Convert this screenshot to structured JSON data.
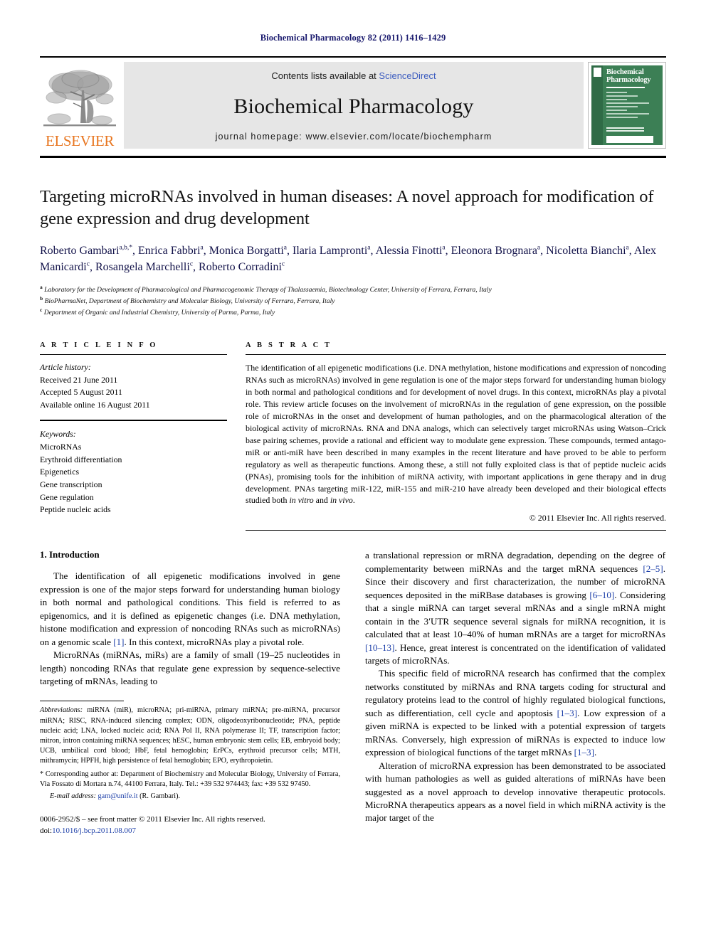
{
  "running_head": "Biochemical Pharmacology 82 (2011) 1416–1429",
  "masthead": {
    "contents_prefix": "Contents lists available at ",
    "sciencedirect": "ScienceDirect",
    "journal_title": "Biochemical Pharmacology",
    "homepage": "journal homepage: www.elsevier.com/locate/biochempharm",
    "publisher_wordmark": "ELSEVIER",
    "cover_title_line1": "Biochemical",
    "cover_title_line2": "Pharmacology"
  },
  "article": {
    "title": "Targeting microRNAs involved in human diseases: A novel approach for modification of gene expression and drug development",
    "authors_line1": "Roberto Gambari",
    "authors": [
      {
        "name": "Roberto Gambari",
        "sup": "a,b,*"
      },
      {
        "name": "Enrica Fabbri",
        "sup": "a"
      },
      {
        "name": "Monica Borgatti",
        "sup": "a"
      },
      {
        "name": "Ilaria Lampronti",
        "sup": "a"
      },
      {
        "name": "Alessia Finotti",
        "sup": "a"
      },
      {
        "name": "Eleonora Brognara",
        "sup": "a"
      },
      {
        "name": "Nicoletta Bianchi",
        "sup": "a"
      },
      {
        "name": "Alex Manicardi",
        "sup": "c"
      },
      {
        "name": "Rosangela Marchelli",
        "sup": "c"
      },
      {
        "name": "Roberto Corradini",
        "sup": "c"
      }
    ],
    "affiliations": [
      {
        "sup": "a",
        "text": "Laboratory for the Development of Pharmacological and Pharmacogenomic Therapy of Thalassaemia, Biotechnology Center, University of Ferrara, Ferrara, Italy"
      },
      {
        "sup": "b",
        "text": "BioPharmaNet, Department of Biochemistry and Molecular Biology, University of Ferrara, Ferrara, Italy"
      },
      {
        "sup": "c",
        "text": "Department of Organic and Industrial Chemistry, University of Parma, Parma, Italy"
      }
    ]
  },
  "article_info": {
    "heading": "A R T I C L E  I N F O",
    "history_label": "Article history:",
    "history": [
      "Received 21 June 2011",
      "Accepted 5 August 2011",
      "Available online 16 August 2011"
    ],
    "keywords_label": "Keywords:",
    "keywords": [
      "MicroRNAs",
      "Erythroid differentiation",
      "Epigenetics",
      "Gene transcription",
      "Gene regulation",
      "Peptide nucleic acids"
    ]
  },
  "abstract": {
    "heading": "A B S T R A C T",
    "part1": "The identification of all epigenetic modifications (i.e. DNA methylation, histone modifications and expression of noncoding RNAs such as microRNAs) involved in gene regulation is one of the major steps forward for understanding human biology in both normal and pathological conditions and for development of novel drugs. In this context, microRNAs play a pivotal role. This review article focuses on the involvement of microRNAs in the regulation of gene expression, on the possible role of microRNAs in the onset and development of human pathologies, and on the pharmacological alteration of the biological activity of microRNAs. RNA and DNA analogs, which can selectively target microRNAs using Watson–Crick base pairing schemes, provide a rational and efficient way to modulate gene expression. These compounds, termed antago-miR or anti-miR have been described in many examples in the recent literature and have proved to be able to perform regulatory as well as therapeutic functions. Among these, a still not fully exploited class is that of peptide nucleic acids (PNAs), promising tools for the inhibition of miRNA activity, with important applications in gene therapy and in drug development. PNAs targeting miR-122, miR-155 and miR-210 have already been developed and their biological effects studied both ",
    "italic1": "in vitro",
    "mid": " and ",
    "italic2": "in vivo",
    "part2": ".",
    "copyright": "© 2011 Elsevier Inc. All rights reserved."
  },
  "section": {
    "number_title": "1. Introduction"
  },
  "left_column": {
    "p1_a": "The identification of all epigenetic modifications involved in gene expression is one of the major steps forward for understanding human biology in both normal and pathological conditions. This field is referred to as epigenomics, and it is defined as epigenetic changes (i.e. DNA methylation, histone modification and expression of noncoding RNAs such as microRNAs) on a genomic scale ",
    "p1_ref": "[1]",
    "p1_b": ". In this context, microRNAs play a pivotal role.",
    "p2": "MicroRNAs (miRNAs, miRs) are a family of small (19–25 nucleotides in length) noncoding RNAs that regulate gene expression by sequence-selective targeting of mRNAs, leading to"
  },
  "right_column": {
    "p1_a": "a translational repression or mRNA degradation, depending on the degree of complementarity between miRNAs and the target mRNA sequences ",
    "p1_ref1": "[2–5]",
    "p1_b": ". Since their discovery and first characterization, the number of microRNA sequences deposited in the miRBase databases is growing ",
    "p1_ref2": "[6–10]",
    "p1_c": ". Considering that a single miRNA can target several mRNAs and a single mRNA might contain in the 3′UTR sequence several signals for miRNA recognition, it is calculated that at least 10–40% of human mRNAs are a target for microRNAs ",
    "p1_ref3": "[10–13]",
    "p1_d": ". Hence, great interest is concentrated on the identification of validated targets of microRNAs.",
    "p2_a": "This specific field of microRNA research has confirmed that the complex networks constituted by miRNAs and RNA targets coding for structural and regulatory proteins lead to the control of highly regulated biological functions, such as differentiation, cell cycle and apoptosis ",
    "p2_ref1": "[1–3]",
    "p2_b": ". Low expression of a given miRNA is expected to be linked with a potential expression of targets mRNAs. Conversely, high expression of miRNAs is expected to induce low expression of biological functions of the target mRNAs ",
    "p2_ref2": "[1–3]",
    "p2_c": ".",
    "p3": "Alteration of microRNA expression has been demonstrated to be associated with human pathologies as well as guided alterations of miRNAs have been suggested as a novel approach to develop innovative therapeutic protocols. MicroRNA therapeutics appears as a novel field in which miRNA activity is the major target of the"
  },
  "footnote": {
    "abbrev_label": "Abbreviations:",
    "abbrev_text": " miRNA (miR), microRNA; pri-miRNA, primary miRNA; pre-miRNA, precursor miRNA; RISC, RNA-induced silencing complex; ODN, oligodeoxyribonucleotide; PNA, peptide nucleic acid; LNA, locked nucleic acid; RNA Pol II, RNA polymerase II; TF, transcription factor; mitron, intron containing miRNA sequences; hESC, human embryonic stem cells; EB, embryoid body; UCB, umbilical cord blood; HbF, fetal hemoglobin; ErPCs, erythroid precursor cells; MTH, mithramycin; HPFH, high persistence of fetal hemoglobin; EPO, erythropoietin.",
    "corresponding": "* Corresponding author at: Department of Biochemistry and Molecular Biology, University of Ferrara, Via Fossato di Mortara n.74, 44100 Ferrara, Italy. Tel.: +39 532 974443; fax: +39 532 97450.",
    "email_label": "E-mail address:",
    "email": "gam@unife.it",
    "email_suffix": " (R. Gambari).",
    "imprint_line1": "0006-2952/$ – see front matter © 2011 Elsevier Inc. All rights reserved.",
    "imprint_doi_label": "doi:",
    "imprint_doi": "10.1016/j.bcp.2011.08.007"
  },
  "colors": {
    "running_head": "#1a1a6e",
    "link_blue": "#1d3fa8",
    "sciencedirect_blue": "#3b5bbf",
    "elsevier_orange": "#E87722",
    "cover_green": "#3c7f55",
    "masthead_gray": "#e6e6e6"
  }
}
